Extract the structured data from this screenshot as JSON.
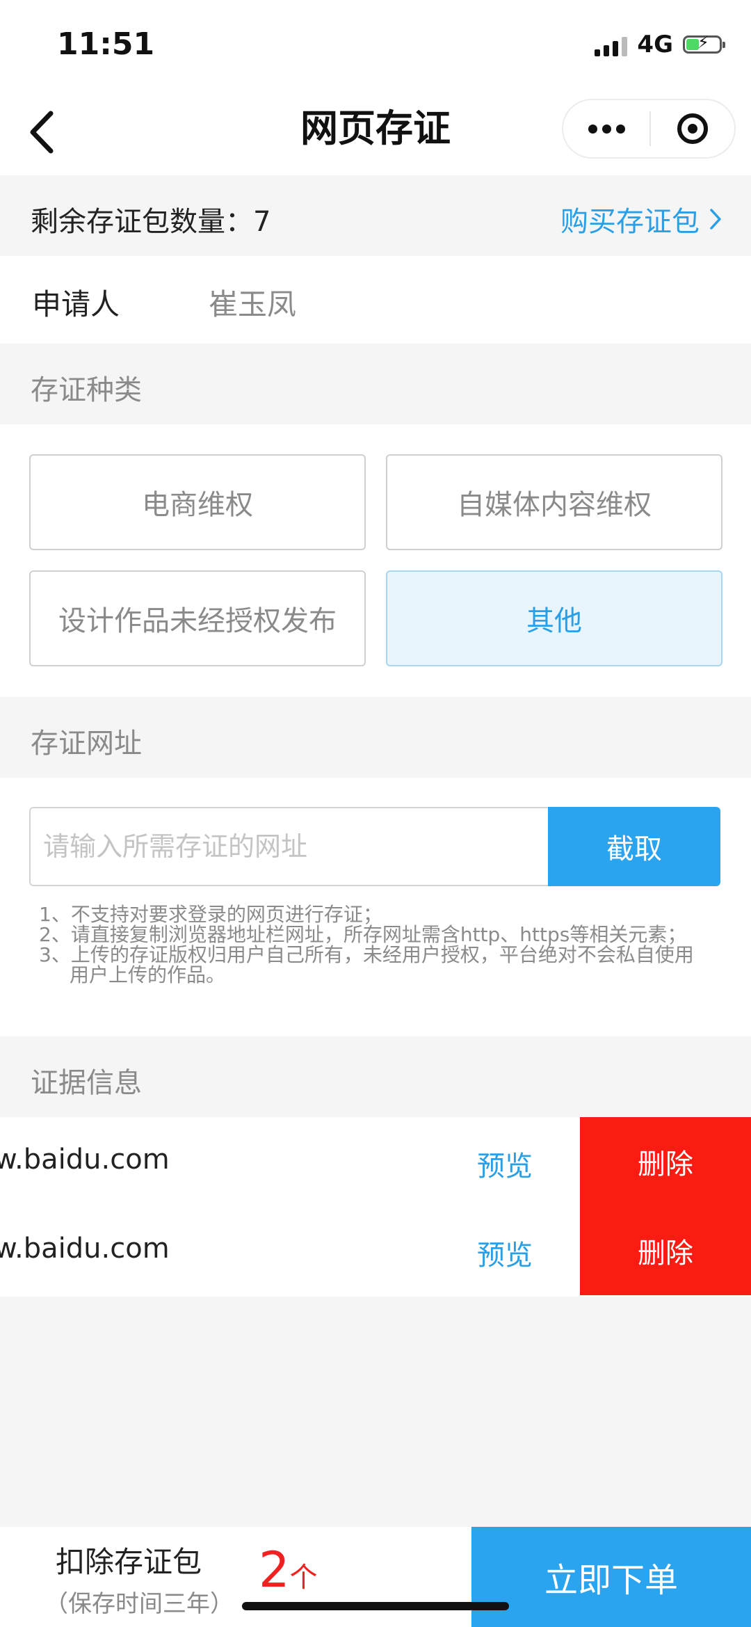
{
  "status_bar": {
    "time": "11:51",
    "network": "4G"
  },
  "nav": {
    "title": "网页存证"
  },
  "remaining": {
    "label": "剩余存证包数量：7",
    "buy_link": "购买存证包"
  },
  "applicant": {
    "label": "申请人",
    "value": "崔玉凤"
  },
  "types": {
    "section_title": "存证种类",
    "options": [
      "电商维权",
      "自媒体内容维权",
      "设计作品未经授权发布",
      "其他"
    ],
    "selected": "其他"
  },
  "url": {
    "section_title": "存证网址",
    "placeholder": "请输入所需存证的网址",
    "value": "",
    "capture_label": "截取",
    "notes": [
      "1、不支持对要求登录的网页进行存证；",
      "2、请直接复制浏览器地址栏网址，所存网址需含http、https等相关元素；",
      "3、上传的存证版权归用户自己所有，未经用户授权，平台绝对不会私自使用",
      "用户上传的作品。"
    ]
  },
  "evidence": {
    "section_title": "证据信息",
    "items": [
      {
        "url": "w.baidu.com",
        "preview_label": "预览",
        "delete_label": "删除"
      },
      {
        "url": "w.baidu.com",
        "preview_label": "预览",
        "delete_label": "删除"
      }
    ]
  },
  "bottom": {
    "deduct_label": "扣除存证包",
    "deduct_note": "（保存时间三年）",
    "count": "2",
    "count_unit": "个",
    "order_label": "立即下单"
  },
  "colors": {
    "accent": "#2aa4ef",
    "delete": "#fa1b13",
    "count": "#f22121"
  }
}
